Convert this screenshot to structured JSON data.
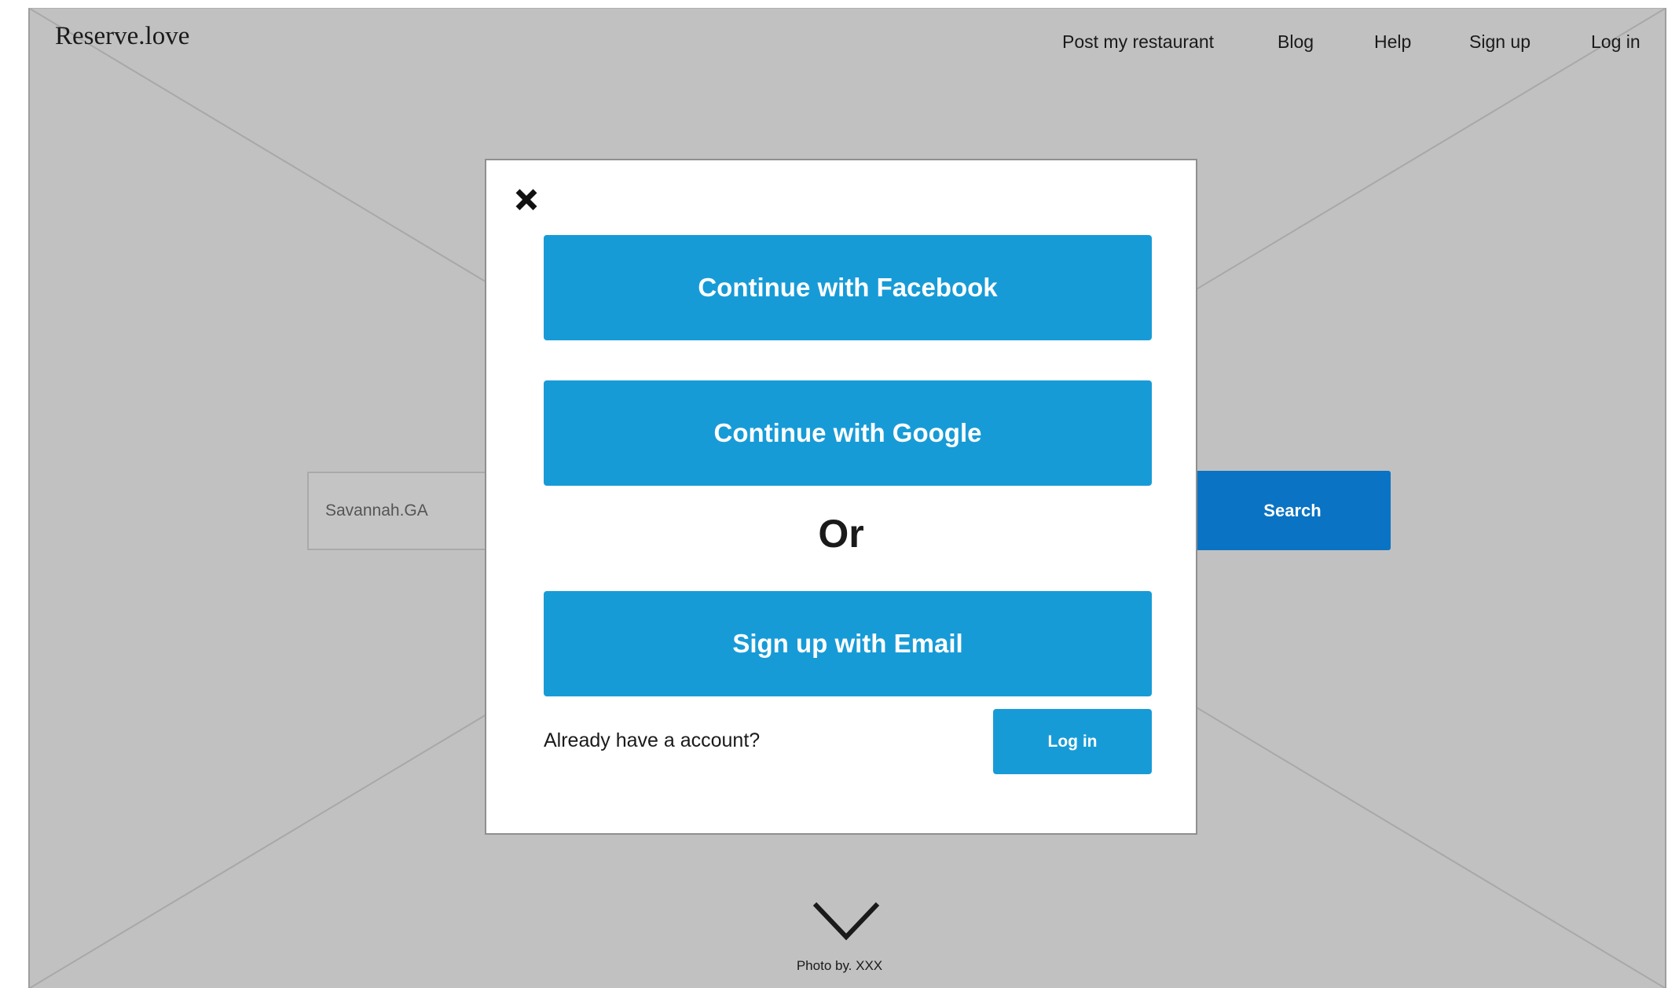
{
  "header": {
    "logo": "Reserve.love",
    "nav": {
      "post_restaurant": "Post my restaurant",
      "blog": "Blog",
      "help": "Help",
      "sign_up": "Sign up",
      "log_in": "Log in"
    }
  },
  "search": {
    "location_value": "Savannah.GA",
    "button_label": "Search"
  },
  "modal": {
    "close_icon": "close-icon",
    "facebook_label": "Continue with Facebook",
    "google_label": "Continue with Google",
    "or_label": "Or",
    "email_label": "Sign up with Email",
    "already_account": "Already have a account?",
    "login_label": "Log in"
  },
  "footer": {
    "scroll_icon": "chevron-down-icon",
    "photo_credit": "Photo by. XXX"
  },
  "colors": {
    "background": "#c1c1c1",
    "modal_button": "#179bd7",
    "search_button": "#0a73c3"
  }
}
